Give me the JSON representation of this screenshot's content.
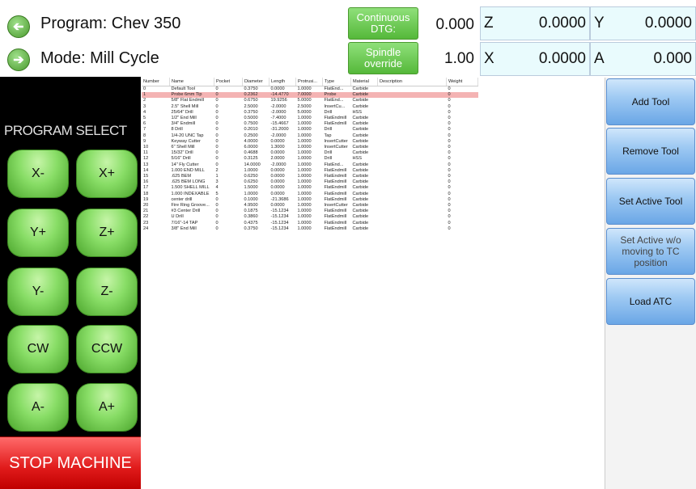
{
  "header": {
    "program": "Program: Chev 350",
    "mode": "Mode: Mill Cycle",
    "continuous_btn": "Continuous DTG:",
    "continuous_val": "0.000",
    "spindle_btn": "Spindle override",
    "spindle_val": "1.00",
    "z_label": "Z",
    "z_val": "0.0000",
    "y_label": "Y",
    "y_val": "0.0000",
    "x_label": "X",
    "x_val": "0.0000",
    "a_label": "A",
    "a_val": "0.000"
  },
  "left": {
    "program_select": "PROGRAM SELECT",
    "jog": [
      "X-",
      "X+",
      "Y+",
      "Z+",
      "Y-",
      "Z-",
      "CW",
      "CCW",
      "A-",
      "A+"
    ],
    "stop": "STOP MACHINE"
  },
  "table": {
    "columns": [
      "Number",
      "Name",
      "Pocket",
      "Diameter",
      "Length",
      "Protrusi...",
      "Type",
      "Material",
      "Description",
      "Weight"
    ],
    "rows": [
      [
        "0",
        "Default Tool",
        "0",
        "0.3750",
        "0.0000",
        "1.0000",
        "FlatEnd...",
        "Carbide",
        "",
        "0"
      ],
      [
        "1",
        "Probe 6mm Tip",
        "0",
        "0.2362",
        "-14.4770",
        "7.0000",
        "Probe",
        "Carbide",
        "",
        "0"
      ],
      [
        "2",
        "5/8\" Flat Endmill",
        "0",
        "0.6750",
        "19.9256",
        "5.0000",
        "FlatEnd...",
        "Carbide",
        "",
        "0"
      ],
      [
        "3",
        "2.5\" Shell Mill",
        "0",
        "2.5000",
        "-2.0000",
        "2.5000",
        "InsertCu...",
        "Carbide",
        "",
        "0"
      ],
      [
        "4",
        "25/64\" Drill",
        "0",
        "0.3750",
        "-2.0000",
        "5.0000",
        "Drill",
        "HSS",
        "",
        "0"
      ],
      [
        "5",
        "1/2\" End Mill",
        "0",
        "0.5000",
        "-7.4000",
        "1.0000",
        "FlatEndmill",
        "Carbide",
        "",
        "0"
      ],
      [
        "6",
        "3/4\" Endmill",
        "0",
        "0.7500",
        "-15.4667",
        "1.0000",
        "FlatEndmill",
        "Carbide",
        "",
        "0"
      ],
      [
        "7",
        "8 Drill",
        "0",
        "0.2010",
        "-31.2000",
        "1.0000",
        "Drill",
        "Carbide",
        "",
        "0"
      ],
      [
        "8",
        "1/4-20 UNC Tap",
        "0",
        "0.2500",
        "-2.0000",
        "1.0000",
        "Tap",
        "Carbide",
        "",
        "0"
      ],
      [
        "9",
        "Keyway Cutter",
        "0",
        "4.0000",
        "0.0000",
        "1.0000",
        "InsertCutter",
        "Carbide",
        "",
        "0"
      ],
      [
        "10",
        "6\" Shell Mill",
        "0",
        "6.0000",
        "1.3000",
        "1.0000",
        "InsertCutter",
        "Carbide",
        "",
        "0"
      ],
      [
        "11",
        "15/32\" Drill",
        "0",
        "0.4688",
        "0.0000",
        "1.0000",
        "Drill",
        "Carbide",
        "",
        "0"
      ],
      [
        "12",
        "5/16\" Drill",
        "0",
        "0.3125",
        "2.0000",
        "1.0000",
        "Drill",
        "HSS",
        "",
        "0"
      ],
      [
        "13",
        "14\" Fly Cutter",
        "0",
        "14.0000",
        "-2.0000",
        "1.0000",
        "FlatEnd...",
        "Carbide",
        "",
        "0"
      ],
      [
        "14",
        "1.000 END MILL",
        "2",
        "1.0000",
        "0.0000",
        "1.0000",
        "FlatEndmill",
        "Carbide",
        "",
        "0"
      ],
      [
        "15",
        ".625 BEM",
        "1",
        "0.6250",
        "0.0000",
        "1.0000",
        "FlatEndmill",
        "Carbide",
        "",
        "0"
      ],
      [
        "16",
        ".625 BEM LONG",
        "3",
        "0.6250",
        "0.0000",
        "1.0000",
        "FlatEndmill",
        "Carbide",
        "",
        "0"
      ],
      [
        "17",
        "1.500 SHELL MILL",
        "4",
        "1.5000",
        "0.0000",
        "1.0000",
        "FlatEndmill",
        "Carbide",
        "",
        "0"
      ],
      [
        "18",
        "1.000 INDEXABLE",
        "5",
        "1.0000",
        "0.0000",
        "1.0000",
        "FlatEndmill",
        "Carbide",
        "",
        "0"
      ],
      [
        "19",
        "center drill",
        "0",
        "0.1000",
        "-21.3686",
        "1.0000",
        "FlatEndmill",
        "Carbide",
        "",
        "0"
      ],
      [
        "20",
        "Fire Ring Groove...",
        "0",
        "4.9500",
        "0.0000",
        "1.0000",
        "InsertCutter",
        "Carbide",
        "",
        "0"
      ],
      [
        "21",
        "#3 Center Drill",
        "0",
        "0.1875",
        "-15.1234",
        "1.0000",
        "FlatEndmill",
        "Carbide",
        "",
        "0"
      ],
      [
        "22",
        "U Drill",
        "0",
        "0.3860",
        "-15.1234",
        "1.0000",
        "FlatEndmill",
        "Carbide",
        "",
        "0"
      ],
      [
        "23",
        "7/16\"-14 TAP",
        "0",
        "0.4375",
        "-15.1234",
        "1.0000",
        "FlatEndmill",
        "Carbide",
        "",
        "0"
      ],
      [
        "24",
        "3/8\" End Mill",
        "0",
        "0.3750",
        "-15.1234",
        "1.0000",
        "FlatEndmill",
        "Carbide",
        "",
        "0"
      ]
    ],
    "selected_row": 1
  },
  "right": {
    "buttons": [
      "Add Tool",
      "Remove Tool",
      "Set Active Tool",
      "Set Active w/o moving to TC position",
      "Load ATC"
    ]
  },
  "icons": {
    "back": "arrow-left-icon",
    "forward": "arrow-right-icon"
  },
  "colors": {
    "jog_green": "#88dd66",
    "stop_red": "#e01a1a",
    "panel_blue": "#9fcaf3",
    "dro_bg": "#e9fbfd",
    "selected_row": "#f4b3b3"
  }
}
